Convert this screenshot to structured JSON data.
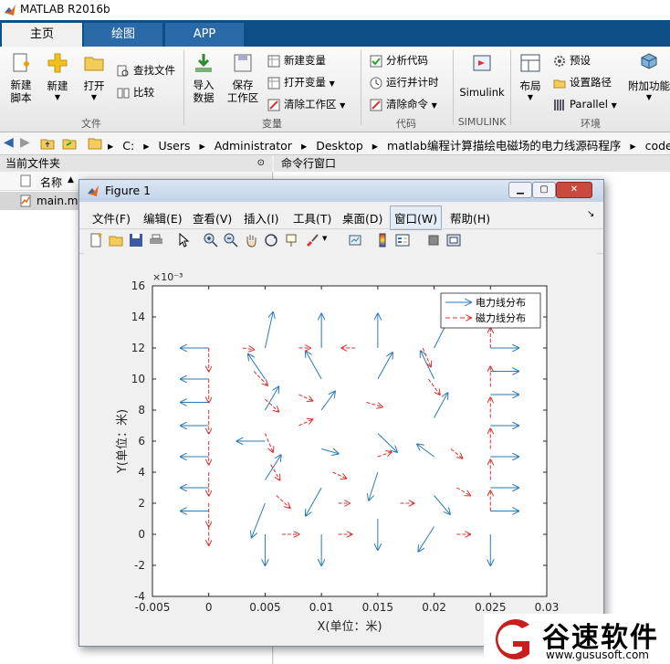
{
  "app": {
    "title": "MATLAB R2016b"
  },
  "tabs": [
    {
      "label": "主页"
    },
    {
      "label": "绘图"
    },
    {
      "label": "APP"
    }
  ],
  "ribbon": {
    "file": {
      "new_script": "新建\n脚本",
      "new": "新建",
      "open": "打开",
      "find_files": "查找文件",
      "compare": "比较",
      "group": "文件"
    },
    "variable": {
      "import": "导入\n数据",
      "save_ws": "保存\n工作区",
      "new_var": "新建变量",
      "open_var": "打开变量",
      "clear_ws": "清除工作区",
      "group": "变量"
    },
    "code": {
      "analyze": "分析代码",
      "run_time": "运行并计时",
      "clear_cmd": "清除命令",
      "group": "代码"
    },
    "simulink": {
      "label": "Simulink",
      "group": "SIMULINK"
    },
    "env": {
      "layout": "布局",
      "prefs": "预设",
      "set_path": "设置路径",
      "parallel": "Parallel",
      "addons": "附加功能",
      "group": "环境"
    }
  },
  "address": {
    "parts": [
      "C:",
      "Users",
      "Administrator",
      "Desktop",
      "matlab编程计算描绘电磁场的电力线源码程序",
      "code"
    ]
  },
  "current_folder": {
    "title": "当前文件夹",
    "col_name": "名称",
    "sort_arrow": "▲",
    "files": [
      {
        "name": "main.m"
      }
    ]
  },
  "command_window": {
    "title": "命令行窗口"
  },
  "figure": {
    "title": "Figure 1",
    "menu": [
      "文件(F)",
      "编辑(E)",
      "查看(V)",
      "插入(I)",
      "工具(T)",
      "桌面(D)",
      "窗口(W)",
      "帮助(H)"
    ],
    "active_menu": "窗口(W)"
  },
  "chart_data": {
    "type": "quiver",
    "xlabel": "X(单位：米)",
    "ylabel": "Y(单位：米)",
    "xlim": [
      -0.005,
      0.03
    ],
    "ylim": [
      -4,
      16
    ],
    "y_multiplier": "×10⁻³",
    "xticks": [
      "-0.005",
      "0",
      "0.005",
      "0.01",
      "0.015",
      "0.02",
      "0.025",
      "0.03"
    ],
    "yticks": [
      "-4",
      "-2",
      "0",
      "2",
      "4",
      "6",
      "8",
      "10",
      "12",
      "14",
      "16"
    ],
    "legend": {
      "position": "top-right",
      "entries": [
        "电力线分布",
        "磁力线分布"
      ]
    },
    "colors": {
      "electric": "#2a7ab8",
      "magnetic": "#e03030"
    },
    "grid": false,
    "series": [
      {
        "name": "电力线分布",
        "points": [
          {
            "x": 0,
            "y": 12,
            "u": -0.0025,
            "v": 0
          },
          {
            "x": 0,
            "y": 10,
            "u": -0.0025,
            "v": 0
          },
          {
            "x": 0,
            "y": 8.5,
            "u": -0.0025,
            "v": 0
          },
          {
            "x": 0,
            "y": 7,
            "u": -0.0025,
            "v": 0
          },
          {
            "x": 0,
            "y": 5,
            "u": -0.0025,
            "v": 0
          },
          {
            "x": 0,
            "y": 3,
            "u": -0.0025,
            "v": 0
          },
          {
            "x": 0,
            "y": 1.5,
            "u": -0.0025,
            "v": 0
          },
          {
            "x": 0.005,
            "y": 12,
            "u": 0.0007,
            "v": 2.3
          },
          {
            "x": 0.005,
            "y": 10,
            "u": -0.0015,
            "v": 1.6
          },
          {
            "x": 0.005,
            "y": 8,
            "u": 0.0012,
            "v": 1.5
          },
          {
            "x": 0.005,
            "y": 6,
            "u": -0.0025,
            "v": 0.0
          },
          {
            "x": 0.005,
            "y": 3.5,
            "u": 0.0014,
            "v": 1.6
          },
          {
            "x": 0.005,
            "y": 2,
            "u": -0.0012,
            "v": -2.2
          },
          {
            "x": 0.005,
            "y": 0,
            "u": 0,
            "v": -2.0
          },
          {
            "x": 0.01,
            "y": 12,
            "u": 0,
            "v": 2.2
          },
          {
            "x": 0.01,
            "y": 10,
            "u": -0.0014,
            "v": 1.8
          },
          {
            "x": 0.01,
            "y": 8,
            "u": 0.0012,
            "v": 1.2
          },
          {
            "x": 0.01,
            "y": 5.5,
            "u": 0.0015,
            "v": -0.3
          },
          {
            "x": 0.01,
            "y": 3,
            "u": -0.0014,
            "v": -1.8
          },
          {
            "x": 0.01,
            "y": 0,
            "u": 0,
            "v": -2.0
          },
          {
            "x": 0.015,
            "y": 12,
            "u": 0,
            "v": 2.2
          },
          {
            "x": 0.015,
            "y": 10,
            "u": 0.0013,
            "v": 1.7
          },
          {
            "x": 0.015,
            "y": 6.5,
            "u": 0.0017,
            "v": -1.2
          },
          {
            "x": 0.015,
            "y": 4,
            "u": -0.0008,
            "v": -1.8
          },
          {
            "x": 0.015,
            "y": 1,
            "u": 0,
            "v": -2.0
          },
          {
            "x": 0.02,
            "y": 12,
            "u": 0.0014,
            "v": 2.0
          },
          {
            "x": 0.02,
            "y": 10,
            "u": -0.0012,
            "v": 1.8
          },
          {
            "x": 0.02,
            "y": 7.5,
            "u": 0.0012,
            "v": 1.6
          },
          {
            "x": 0.02,
            "y": 5,
            "u": -0.0015,
            "v": 0.8
          },
          {
            "x": 0.02,
            "y": 2.5,
            "u": 0.0014,
            "v": -1.2
          },
          {
            "x": 0.02,
            "y": 0.5,
            "u": -0.0014,
            "v": -1.6
          },
          {
            "x": 0.025,
            "y": 12,
            "u": 0.0025,
            "v": 0
          },
          {
            "x": 0.025,
            "y": 10.5,
            "u": 0.0025,
            "v": 0
          },
          {
            "x": 0.025,
            "y": 9,
            "u": 0.0025,
            "v": 0
          },
          {
            "x": 0.025,
            "y": 7,
            "u": 0.0025,
            "v": 0
          },
          {
            "x": 0.025,
            "y": 5,
            "u": 0.0025,
            "v": 0
          },
          {
            "x": 0.025,
            "y": 3,
            "u": 0.0025,
            "v": 0
          },
          {
            "x": 0.025,
            "y": 1.5,
            "u": 0.0025,
            "v": 0
          },
          {
            "x": 0.025,
            "y": 0,
            "u": 0,
            "v": -2.0
          }
        ]
      },
      {
        "name": "磁力线分布",
        "points": [
          {
            "x": 0,
            "y": 12,
            "u": 0,
            "v": -1.5
          },
          {
            "x": 0,
            "y": 10,
            "u": 0,
            "v": -1.5
          },
          {
            "x": 0,
            "y": 8,
            "u": 0,
            "v": -1.5
          },
          {
            "x": 0,
            "y": 6,
            "u": 0,
            "v": -1.5
          },
          {
            "x": 0,
            "y": 4,
            "u": 0,
            "v": -1.5
          },
          {
            "x": 0,
            "y": 2,
            "u": 0,
            "v": -1.5
          },
          {
            "x": 0,
            "y": 0.5,
            "u": 0,
            "v": -1.2
          },
          {
            "x": 0.003,
            "y": 12,
            "u": 0.001,
            "v": -0.1
          },
          {
            "x": 0.004,
            "y": 10.5,
            "u": 0.0012,
            "v": -0.9
          },
          {
            "x": 0.005,
            "y": 8.7,
            "u": 0.0012,
            "v": -0.8
          },
          {
            "x": 0.005,
            "y": 6.5,
            "u": 0.0007,
            "v": -1.2
          },
          {
            "x": 0.0055,
            "y": 4.5,
            "u": 0.0008,
            "v": -1.0
          },
          {
            "x": 0.006,
            "y": 2.5,
            "u": 0.0012,
            "v": -0.8
          },
          {
            "x": 0.0065,
            "y": 0,
            "u": 0.0015,
            "v": 0
          },
          {
            "x": 0.008,
            "y": 12,
            "u": 0.001,
            "v": 0
          },
          {
            "x": 0.008,
            "y": 9,
            "u": 0.0012,
            "v": -0.4
          },
          {
            "x": 0.008,
            "y": 7,
            "u": 0.0012,
            "v": 0.4
          },
          {
            "x": 0.011,
            "y": 4,
            "u": 0.0012,
            "v": -0.4
          },
          {
            "x": 0.0115,
            "y": 2,
            "u": 0.001,
            "v": 0
          },
          {
            "x": 0.0115,
            "y": 0,
            "u": 0.0012,
            "v": 0
          },
          {
            "x": 0.013,
            "y": 12,
            "u": -0.0012,
            "v": 0
          },
          {
            "x": 0.014,
            "y": 8.5,
            "u": 0.0014,
            "v": -0.3
          },
          {
            "x": 0.015,
            "y": 5,
            "u": 0.0012,
            "v": 0.3
          },
          {
            "x": 0.017,
            "y": 2,
            "u": 0.0012,
            "v": 0
          },
          {
            "x": 0.019,
            "y": 12,
            "u": 0.0007,
            "v": -1.2
          },
          {
            "x": 0.0195,
            "y": 10,
            "u": 0.001,
            "v": -1.0
          },
          {
            "x": 0.0215,
            "y": 5.5,
            "u": 0.001,
            "v": -0.6
          },
          {
            "x": 0.022,
            "y": 3,
            "u": 0.0012,
            "v": -0.5
          },
          {
            "x": 0.022,
            "y": 0,
            "u": 0.0012,
            "v": 0
          },
          {
            "x": 0.025,
            "y": 12,
            "u": 0,
            "v": 1.3
          },
          {
            "x": 0.025,
            "y": 9.5,
            "u": 0,
            "v": 1.3
          },
          {
            "x": 0.025,
            "y": 7.5,
            "u": 0,
            "v": 1.3
          },
          {
            "x": 0.025,
            "y": 5.5,
            "u": 0,
            "v": 1.3
          },
          {
            "x": 0.025,
            "y": 3.5,
            "u": 0,
            "v": 1.3
          },
          {
            "x": 0.025,
            "y": 1.5,
            "u": 0,
            "v": 1.3
          }
        ]
      }
    ]
  },
  "watermark": {
    "brand_cn": "谷速软件",
    "url": "www.gususoft.com"
  }
}
